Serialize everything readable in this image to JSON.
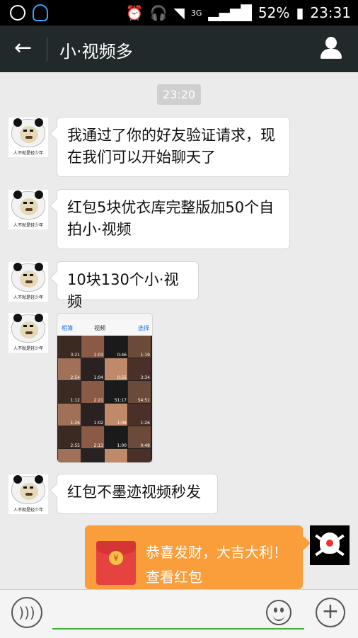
{
  "status_bar": {
    "network": "3G",
    "battery": "52%",
    "time": "23:31"
  },
  "header": {
    "back_icon": "arrow-left-icon",
    "title": "小·视频多",
    "profile_icon": "person-icon"
  },
  "chat": {
    "timestamp": "23:20",
    "messages": [
      {
        "sender": "contact",
        "text": "我通过了你的好友验证请求，现在我们可以开始聊天了"
      },
      {
        "sender": "contact",
        "text": "红包5块优衣库完整版加50个自拍小·视频"
      },
      {
        "sender": "contact",
        "text": "10块130个小·视频"
      },
      {
        "sender": "contact",
        "type": "image",
        "phone_screenshot": {
          "nav_left": "相簿",
          "nav_title": "视频",
          "nav_right": "选择",
          "durations": [
            "3:21",
            "1:03",
            "0:46",
            "1:19",
            "2:54",
            "1:04",
            "0:55",
            "3:34",
            "1:12",
            "2:21",
            "51:17",
            "54:51",
            "1:26",
            "1:02",
            "1:08",
            "1:26",
            "2:55",
            "2:13",
            "1:00",
            "0:48",
            "2:01",
            "2:05",
            "2:42",
            "0:34"
          ]
        }
      },
      {
        "sender": "contact",
        "text": "红包不墨迹视频秒发"
      },
      {
        "sender": "me",
        "type": "red_packet",
        "title": "恭喜发财，大吉大利！",
        "action": "查看红包"
      }
    ],
    "avatar_caption": "人不就是轻少年"
  },
  "input_bar": {
    "voice_icon": "voice-icon",
    "emoji_icon": "emoji-icon",
    "plus_icon": "plus-icon"
  },
  "colors": {
    "header_bg": "#22292b",
    "chat_bg": "#ebebeb",
    "red_packet": "#fa9d3b",
    "input_underline": "#3cb034"
  }
}
